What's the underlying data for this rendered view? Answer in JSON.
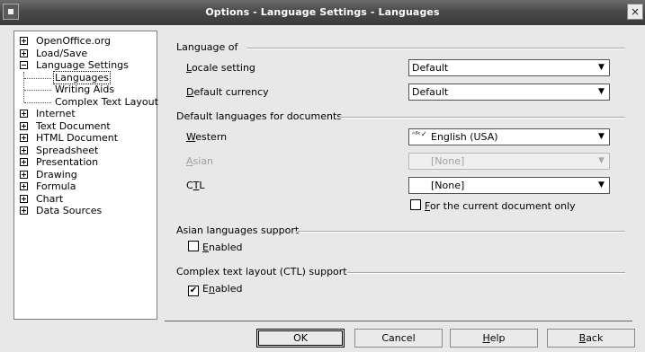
{
  "window": {
    "title": "Options - Language Settings - Languages",
    "close_glyph": "×"
  },
  "tree": {
    "items": [
      {
        "label": "OpenOffice.org",
        "expander": "plus"
      },
      {
        "label": "Load/Save",
        "expander": "plus"
      },
      {
        "label": "Language Settings",
        "expander": "minus"
      },
      {
        "label": "Languages",
        "child": true,
        "selected": true
      },
      {
        "label": "Writing Aids",
        "child": true
      },
      {
        "label": "Complex Text Layout",
        "child": true
      },
      {
        "label": "Internet",
        "expander": "plus"
      },
      {
        "label": "Text Document",
        "expander": "plus"
      },
      {
        "label": "HTML Document",
        "expander": "plus"
      },
      {
        "label": "Spreadsheet",
        "expander": "plus"
      },
      {
        "label": "Presentation",
        "expander": "plus"
      },
      {
        "label": "Drawing",
        "expander": "plus"
      },
      {
        "label": "Formula",
        "expander": "plus"
      },
      {
        "label": "Chart",
        "expander": "plus"
      },
      {
        "label": "Data Sources",
        "expander": "plus"
      }
    ]
  },
  "language_of": {
    "title": "Language of",
    "locale_label_u": "L",
    "locale_label_rest": "ocale setting",
    "locale_value": "Default",
    "currency_label_u": "D",
    "currency_label_rest": "efault currency",
    "currency_value": "Default"
  },
  "default_languages": {
    "title": "Default languages for documents",
    "western_label_u": "W",
    "western_label_rest": "estern",
    "western_value": "English (USA)",
    "western_icon": "spellcheck-icon",
    "asian_label_u": "A",
    "asian_label_rest": "sian",
    "asian_value": "[None]",
    "ctl_label_pre": "C",
    "ctl_label_u": "T",
    "ctl_label_post": "L",
    "ctl_value": "[None]",
    "current_doc_u": "F",
    "current_doc_rest": "or the current document only",
    "current_doc_checked": false
  },
  "asian_support": {
    "title": "Asian languages support",
    "enabled_u": "E",
    "enabled_rest": "nabled",
    "checked": false
  },
  "ctl_support": {
    "title": "Complex text layout (CTL) support",
    "enabled_pre": "E",
    "enabled_u": "n",
    "enabled_post": "abled",
    "checked": true
  },
  "buttons": {
    "ok": "OK",
    "cancel": "Cancel",
    "help_u": "H",
    "help_rest": "elp",
    "back_u": "B",
    "back_rest": "ack"
  },
  "glyphs": {
    "dropdown_arrow": "▼",
    "check": "✔",
    "spell_mark": "ᴬᴮᶜ✓"
  }
}
